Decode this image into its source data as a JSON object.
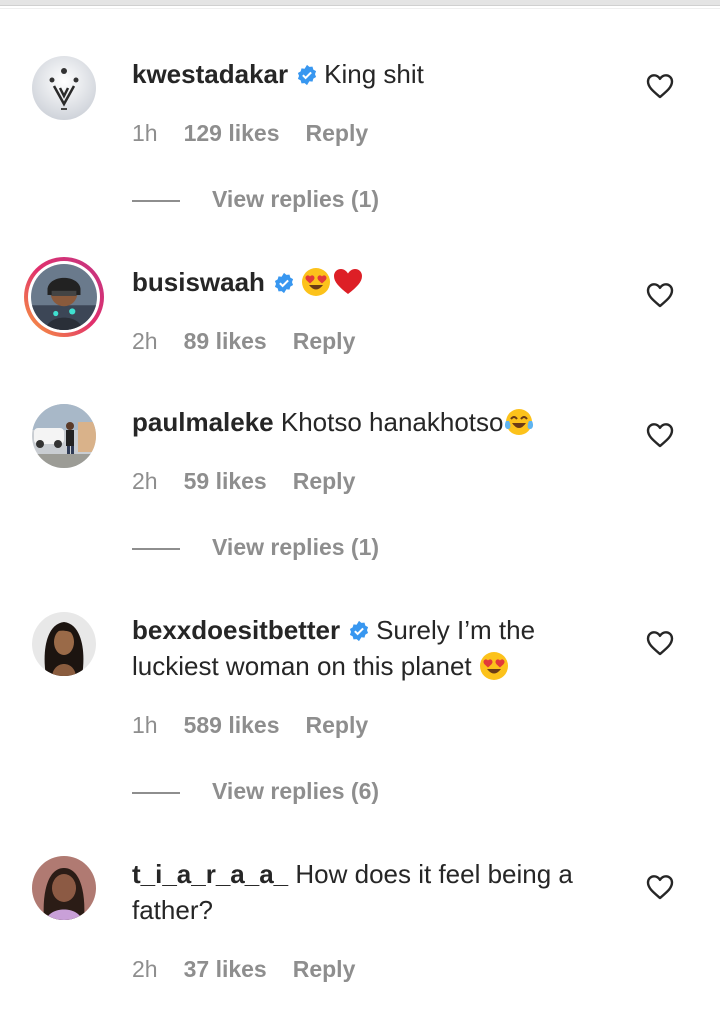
{
  "comments": [
    {
      "username": "kwestadakar",
      "verified": true,
      "text": "King shit",
      "time": "1h",
      "likes": "129 likes",
      "reply": "Reply",
      "view_replies": "View replies (1)"
    },
    {
      "username": "busiswaah",
      "verified": true,
      "text": "",
      "emojis": [
        "heart-eyes-emoji",
        "red-heart-emoji"
      ],
      "time": "2h",
      "likes": "89 likes",
      "reply": "Reply"
    },
    {
      "username": "paulmaleke",
      "verified": false,
      "text": "Khotso hanakhotso",
      "emojis": [
        "tears-of-joy-emoji"
      ],
      "time": "2h",
      "likes": "59 likes",
      "reply": "Reply",
      "view_replies": "View replies (1)"
    },
    {
      "username": "bexxdoesitbetter",
      "verified": true,
      "text": "Surely I’m the luckiest woman on this planet",
      "emojis": [
        "heart-eyes-emoji"
      ],
      "time": "1h",
      "likes": "589 likes",
      "reply": "Reply",
      "view_replies": "View replies (6)"
    },
    {
      "username": "t_i_a_r_a_a_",
      "verified": false,
      "text": "How does it feel being a father?",
      "time": "2h",
      "likes": "37 likes",
      "reply": "Reply"
    }
  ],
  "icons": {
    "like": "heart-outline-icon",
    "verified": "verified-badge-icon"
  },
  "colors": {
    "verified_blue": "#3897f0",
    "muted_text": "#8e8e8e",
    "primary_text": "#262626",
    "story_ring_start": "#f9a23c",
    "story_ring_end": "#c13584"
  }
}
